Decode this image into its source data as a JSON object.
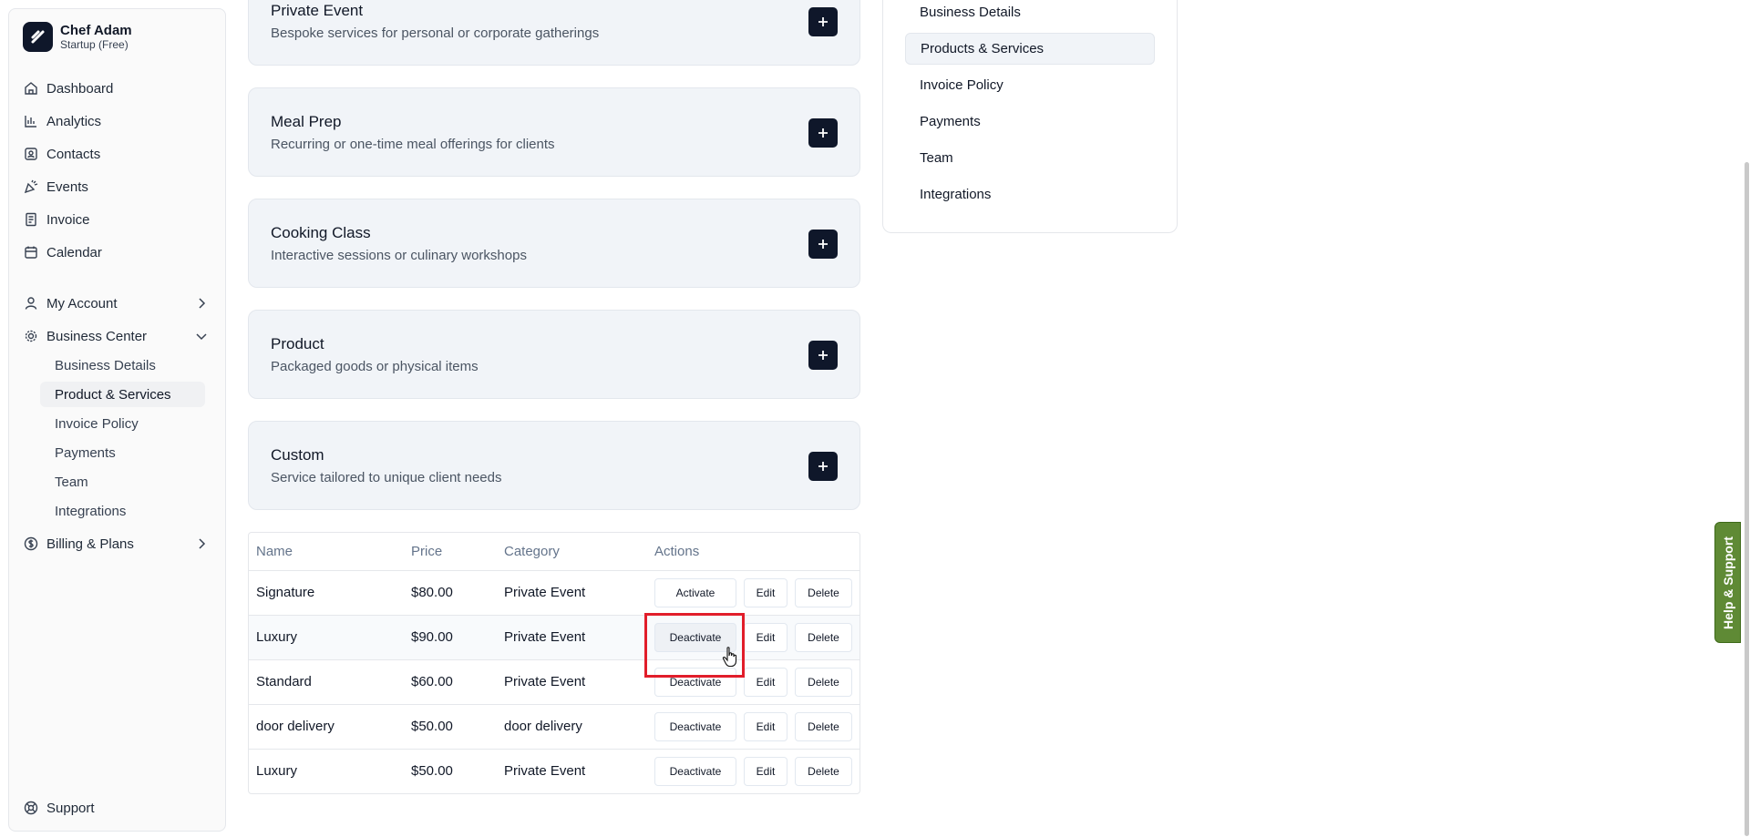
{
  "brand": {
    "name": "Chef Adam",
    "plan": "Startup (Free)"
  },
  "nav": {
    "dashboard": "Dashboard",
    "analytics": "Analytics",
    "contacts": "Contacts",
    "events": "Events",
    "invoice": "Invoice",
    "calendar": "Calendar",
    "my_account": "My Account",
    "business_center": "Business Center",
    "billing": "Billing & Plans",
    "support": "Support",
    "sub": {
      "business_details": "Business Details",
      "product_services": "Product & Services",
      "invoice_policy": "Invoice Policy",
      "payments": "Payments",
      "team": "Team",
      "integrations": "Integrations"
    }
  },
  "cards": [
    {
      "title": "Private Event",
      "desc": "Bespoke services for personal or corporate gatherings"
    },
    {
      "title": "Meal Prep",
      "desc": "Recurring or one-time meal offerings for clients"
    },
    {
      "title": "Cooking Class",
      "desc": "Interactive sessions or culinary workshops"
    },
    {
      "title": "Product",
      "desc": "Packaged goods or physical items"
    },
    {
      "title": "Custom",
      "desc": "Service tailored to unique client needs"
    }
  ],
  "table": {
    "headers": {
      "name": "Name",
      "price": "Price",
      "category": "Category",
      "actions": "Actions"
    },
    "rows": [
      {
        "name": "Signature",
        "price": "$80.00",
        "category": "Private Event",
        "toggle": "Activate",
        "edit": "Edit",
        "delete": "Delete"
      },
      {
        "name": "Luxury",
        "price": "$90.00",
        "category": "Private Event",
        "toggle": "Deactivate",
        "edit": "Edit",
        "delete": "Delete"
      },
      {
        "name": "Standard",
        "price": "$60.00",
        "category": "Private Event",
        "toggle": "Deactivate",
        "edit": "Edit",
        "delete": "Delete"
      },
      {
        "name": "door delivery",
        "price": "$50.00",
        "category": "door delivery",
        "toggle": "Deactivate",
        "edit": "Edit",
        "delete": "Delete"
      },
      {
        "name": "Luxury",
        "price": "$50.00",
        "category": "Private Event",
        "toggle": "Deactivate",
        "edit": "Edit",
        "delete": "Delete"
      }
    ]
  },
  "settings_nav": {
    "business_details": "Business Details",
    "products_services": "Products & Services",
    "invoice_policy": "Invoice Policy",
    "payments": "Payments",
    "team": "Team",
    "integrations": "Integrations"
  },
  "help_tab": "Help & Support",
  "colors": {
    "accent_dark": "#0f172a",
    "highlight": "#e11d2a",
    "help_green": "#5f8a35"
  }
}
